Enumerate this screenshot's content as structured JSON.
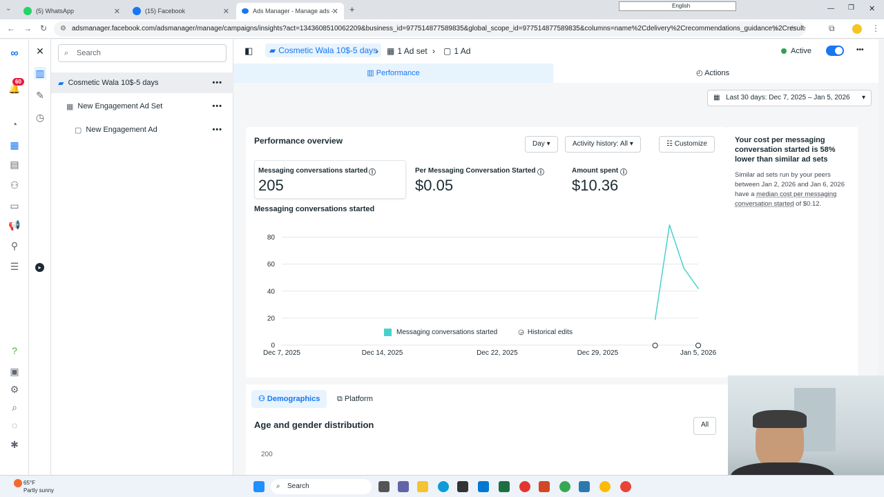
{
  "browser": {
    "tabs": [
      {
        "title": "(5) WhatsApp",
        "color": "#25d366"
      },
      {
        "title": "(15) Facebook",
        "color": "#1877f2"
      },
      {
        "title": "Ads Manager - Manage ads - C",
        "color": "#1877f2"
      }
    ],
    "url": "adsmanager.facebook.com/adsmanager/manage/campaigns/insights?act=1343608510062209&business_id=977514877589835&global_scope_id=977514877589835&columns=name%2Cdelivery%2Crecommendations_guidance%2Cresults%...",
    "lang_label": "English"
  },
  "rail": {
    "notification_count": "60"
  },
  "tree": {
    "search_placeholder": "Search",
    "items": [
      {
        "label": "Cosmetic Wala 10$-5 days",
        "dots": "•••"
      },
      {
        "label": "New Engagement Ad Set",
        "dots": "•••"
      },
      {
        "label": "New Engagement Ad",
        "dots": "•••"
      }
    ]
  },
  "topbar": {
    "campaign": "Cosmetic Wala 10$-5 days",
    "adset": "1 Ad set",
    "ad": "1 Ad",
    "status": "Active",
    "menu": "•••"
  },
  "tabs": {
    "performance": "Performance",
    "actions": "Actions"
  },
  "date_range": "Last 30 days: Dec 7, 2025 – Jan 5, 2026",
  "overview": {
    "title": "Performance overview",
    "day_btn": "Day",
    "history_btn": "Activity history: All",
    "customize_btn": "Customize",
    "metrics": [
      {
        "label": "Messaging conversations started",
        "value": "205"
      },
      {
        "label": "Per Messaging Conversation Started",
        "value": "$0.05"
      },
      {
        "label": "Amount spent",
        "value": "$10.36"
      }
    ],
    "chart_title": "Messaging conversations started",
    "legend_series": "Messaging conversations started",
    "legend_edits": "Historical edits"
  },
  "chart_data": {
    "type": "line",
    "x_ticks": [
      "Dec 7, 2025",
      "Dec 14, 2025",
      "Dec 22, 2025",
      "Dec 29, 2025",
      "Jan 5, 2026"
    ],
    "y_ticks": [
      "0",
      "20",
      "40",
      "60",
      "80"
    ],
    "ylim": [
      0,
      90
    ],
    "series": [
      {
        "name": "Messaging conversations started",
        "x": [
          "Jan 2, 2026",
          "Jan 3, 2026",
          "Jan 4, 2026",
          "Jan 5, 2026"
        ],
        "values": [
          19,
          89,
          57,
          42
        ]
      }
    ],
    "color": "#48d1cc"
  },
  "insight": {
    "heading": "Your cost per messaging conversation started is 58% lower than similar ad sets",
    "body_pre": "Similar ad sets run by your peers between Jan 2, 2026 and Jan 6, 2026 have a ",
    "body_link": "median cost per messaging conversation started",
    "body_post": " of $0.12."
  },
  "lower": {
    "tab_demo": "Demographics",
    "tab_platform": "Platform",
    "title": "Age and gender distribution",
    "filter": "All",
    "y_tick": "200"
  },
  "taskbar": {
    "weather_temp": "65°F",
    "weather_desc": "Partly sunny",
    "search": "Search"
  }
}
